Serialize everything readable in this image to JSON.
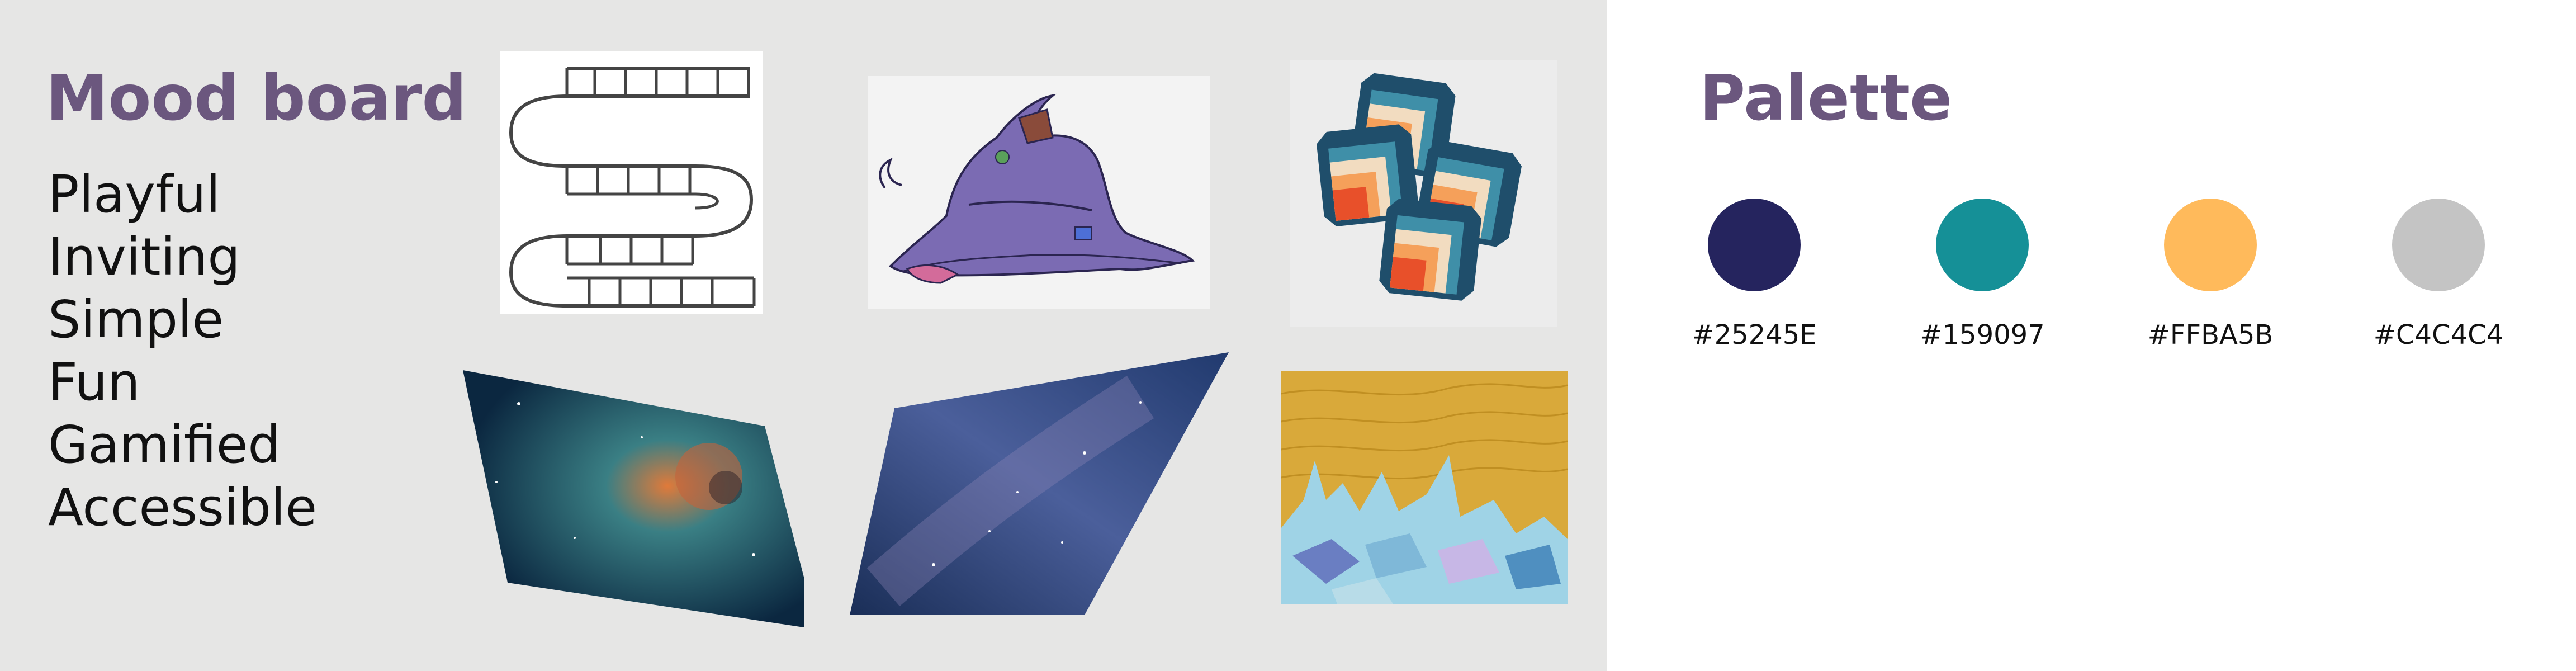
{
  "mood_board": {
    "title": "Mood board",
    "keywords": [
      "Playful",
      "Inviting",
      "Simple",
      "Fun",
      "Gamified",
      "Accessible"
    ]
  },
  "palette": {
    "title": "Palette",
    "swatches": [
      {
        "hex": "#25245E",
        "color": "#25245e"
      },
      {
        "hex": "#159097",
        "color": "#159097"
      },
      {
        "hex": "#FFBA5B",
        "color": "#ffba5b"
      },
      {
        "hex": "#C4C4C4",
        "color": "#c4c4c4"
      }
    ]
  },
  "images": [
    {
      "name": "board-game-path"
    },
    {
      "name": "wizard-hat"
    },
    {
      "name": "retro-coasters"
    },
    {
      "name": "nebula-space"
    },
    {
      "name": "starry-sky"
    },
    {
      "name": "quilt-castle"
    }
  ]
}
